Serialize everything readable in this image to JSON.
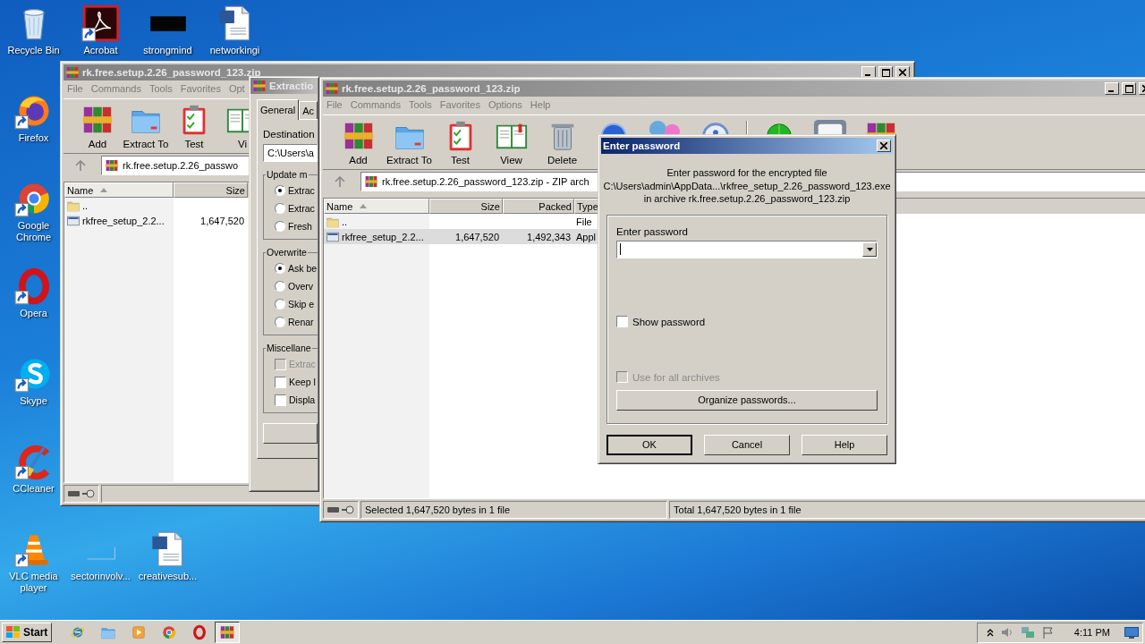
{
  "desktop_icons": [
    {
      "label": "Recycle Bin",
      "kind": "recycle",
      "shortcut": false
    },
    {
      "label": "Acrobat",
      "kind": "pdf",
      "shortcut": true
    },
    {
      "label": "strongmind",
      "kind": "dark",
      "shortcut": false
    },
    {
      "label": "networkingi",
      "kind": "doc",
      "shortcut": false
    },
    {
      "label": "Firefox",
      "kind": "firefox",
      "shortcut": true
    },
    {
      "label": "Google Chrome",
      "kind": "chrome",
      "shortcut": true
    },
    {
      "label": "Opera",
      "kind": "opera",
      "shortcut": true
    },
    {
      "label": "Skype",
      "kind": "skype",
      "shortcut": true
    },
    {
      "label": "CCleaner",
      "kind": "ccleaner",
      "shortcut": true
    },
    {
      "label": "VLC media player",
      "kind": "vlc",
      "shortcut": true
    },
    {
      "label": "sectorinvolv...",
      "kind": "blank",
      "shortcut": false
    },
    {
      "label": "creativesub...",
      "kind": "doc",
      "shortcut": false
    }
  ],
  "back_window": {
    "title": "rk.free.setup.2.26_password_123.zip",
    "active": false,
    "menu": [
      "File",
      "Commands",
      "Tools",
      "Favorites",
      "Opt"
    ],
    "toolbar": [
      {
        "label": "Add",
        "kind": "add"
      },
      {
        "label": "Extract To",
        "kind": "extract"
      },
      {
        "label": "Test",
        "kind": "test"
      },
      {
        "label": "Vi",
        "kind": "view"
      }
    ],
    "address": "rk.free.setup.2.26_passwo",
    "columns": [
      {
        "label": "Name",
        "sorted": true
      },
      {
        "label": "Size",
        "sorted": false
      }
    ],
    "rows": [
      {
        "kind": "parent",
        "selected": false,
        "cells": [
          ".."
        ]
      },
      {
        "kind": "file",
        "selected": false,
        "cells": [
          "rkfree_setup_2.2...",
          "1,647,520"
        ]
      }
    ]
  },
  "extraction_window": {
    "title": "Extractio",
    "active": false,
    "tabs": [
      {
        "label": "General",
        "selected": true
      },
      {
        "label": "Ac",
        "selected": false
      }
    ],
    "destination_label": "Destination",
    "destination": "C:\\Users\\a",
    "groups": [
      {
        "title": "Update m",
        "options": [
          {
            "kind": "radio",
            "label": "Extrac",
            "checked": true,
            "disabled": false
          },
          {
            "kind": "radio",
            "label": "Extrac",
            "checked": false,
            "disabled": false
          },
          {
            "kind": "radio",
            "label": "Fresh",
            "checked": false,
            "disabled": false
          }
        ]
      },
      {
        "title": "Overwrite",
        "options": [
          {
            "kind": "radio",
            "label": "Ask be",
            "checked": true,
            "disabled": false
          },
          {
            "kind": "radio",
            "label": "Overv",
            "checked": false,
            "disabled": false
          },
          {
            "kind": "radio",
            "label": "Skip e",
            "checked": false,
            "disabled": false
          },
          {
            "kind": "radio",
            "label": "Renar",
            "checked": false,
            "disabled": false
          }
        ]
      },
      {
        "title": "Miscellane",
        "options": [
          {
            "kind": "checkbox",
            "label": "Extrac",
            "checked": false,
            "disabled": true
          },
          {
            "kind": "checkbox",
            "label": "Keep l",
            "checked": false,
            "disabled": false
          },
          {
            "kind": "checkbox",
            "label": "Displa",
            "checked": false,
            "disabled": false
          }
        ]
      }
    ]
  },
  "archive_window": {
    "title": "rk.free.setup.2.26_password_123.zip",
    "active": false,
    "menu": [
      "File",
      "Commands",
      "Tools",
      "Favorites",
      "Options",
      "Help"
    ],
    "toolbar": [
      {
        "label": "Add",
        "kind": "add"
      },
      {
        "label": "Extract To",
        "kind": "extract"
      },
      {
        "label": "Test",
        "kind": "test"
      },
      {
        "label": "View",
        "kind": "view"
      },
      {
        "label": "Delete",
        "kind": "delete"
      },
      {
        "kind": "find"
      },
      {
        "kind": "wizard"
      },
      {
        "kind": "info"
      },
      {
        "kind": "virus"
      },
      {
        "kind": "comment"
      },
      {
        "kind": "sfx"
      }
    ],
    "address": "rk.free.setup.2.26_password_123.zip - ZIP arch",
    "columns": [
      {
        "label": "Name",
        "sorted": true
      },
      {
        "label": "Size",
        "sorted": false
      },
      {
        "label": "Packed",
        "sorted": false
      },
      {
        "label": "Type",
        "sorted": false
      }
    ],
    "rows": [
      {
        "kind": "parent",
        "selected": false,
        "cells": [
          "..",
          "",
          "",
          "File"
        ]
      },
      {
        "kind": "file",
        "selected": true,
        "cells": [
          "rkfree_setup_2.2...",
          "1,647,520",
          "1,492,343",
          "Appl"
        ]
      }
    ],
    "status": [
      "Selected 1,647,520 bytes in 1 file",
      "Total 1,647,520 bytes in 1 file"
    ]
  },
  "password_dialog": {
    "title": "Enter password",
    "active": true,
    "message_lines": [
      "Enter password for the encrypted file",
      "C:\\Users\\admin\\AppData...\\rkfree_setup_2.26_password_123.exe",
      "in archive rk.free.setup.2.26_password_123.zip"
    ],
    "field_label": "Enter password",
    "options": [
      {
        "label": "Show password",
        "checked": false,
        "disabled": false
      },
      {
        "label": "Use for all archives",
        "checked": false,
        "disabled": true
      }
    ],
    "organize_button": "Organize passwords...",
    "buttons": [
      {
        "label": "OK",
        "default": true
      },
      {
        "label": "Cancel",
        "default": false
      },
      {
        "label": "Help",
        "default": false
      }
    ]
  },
  "taskbar": {
    "start": "Start",
    "quick_launch": [
      {
        "kind": "ie"
      },
      {
        "kind": "explorer"
      },
      {
        "kind": "media"
      },
      {
        "kind": "chrome"
      },
      {
        "kind": "opera"
      }
    ],
    "tasks": [
      {
        "kind": "add",
        "selected": true
      }
    ],
    "clock": "4:11 PM"
  }
}
